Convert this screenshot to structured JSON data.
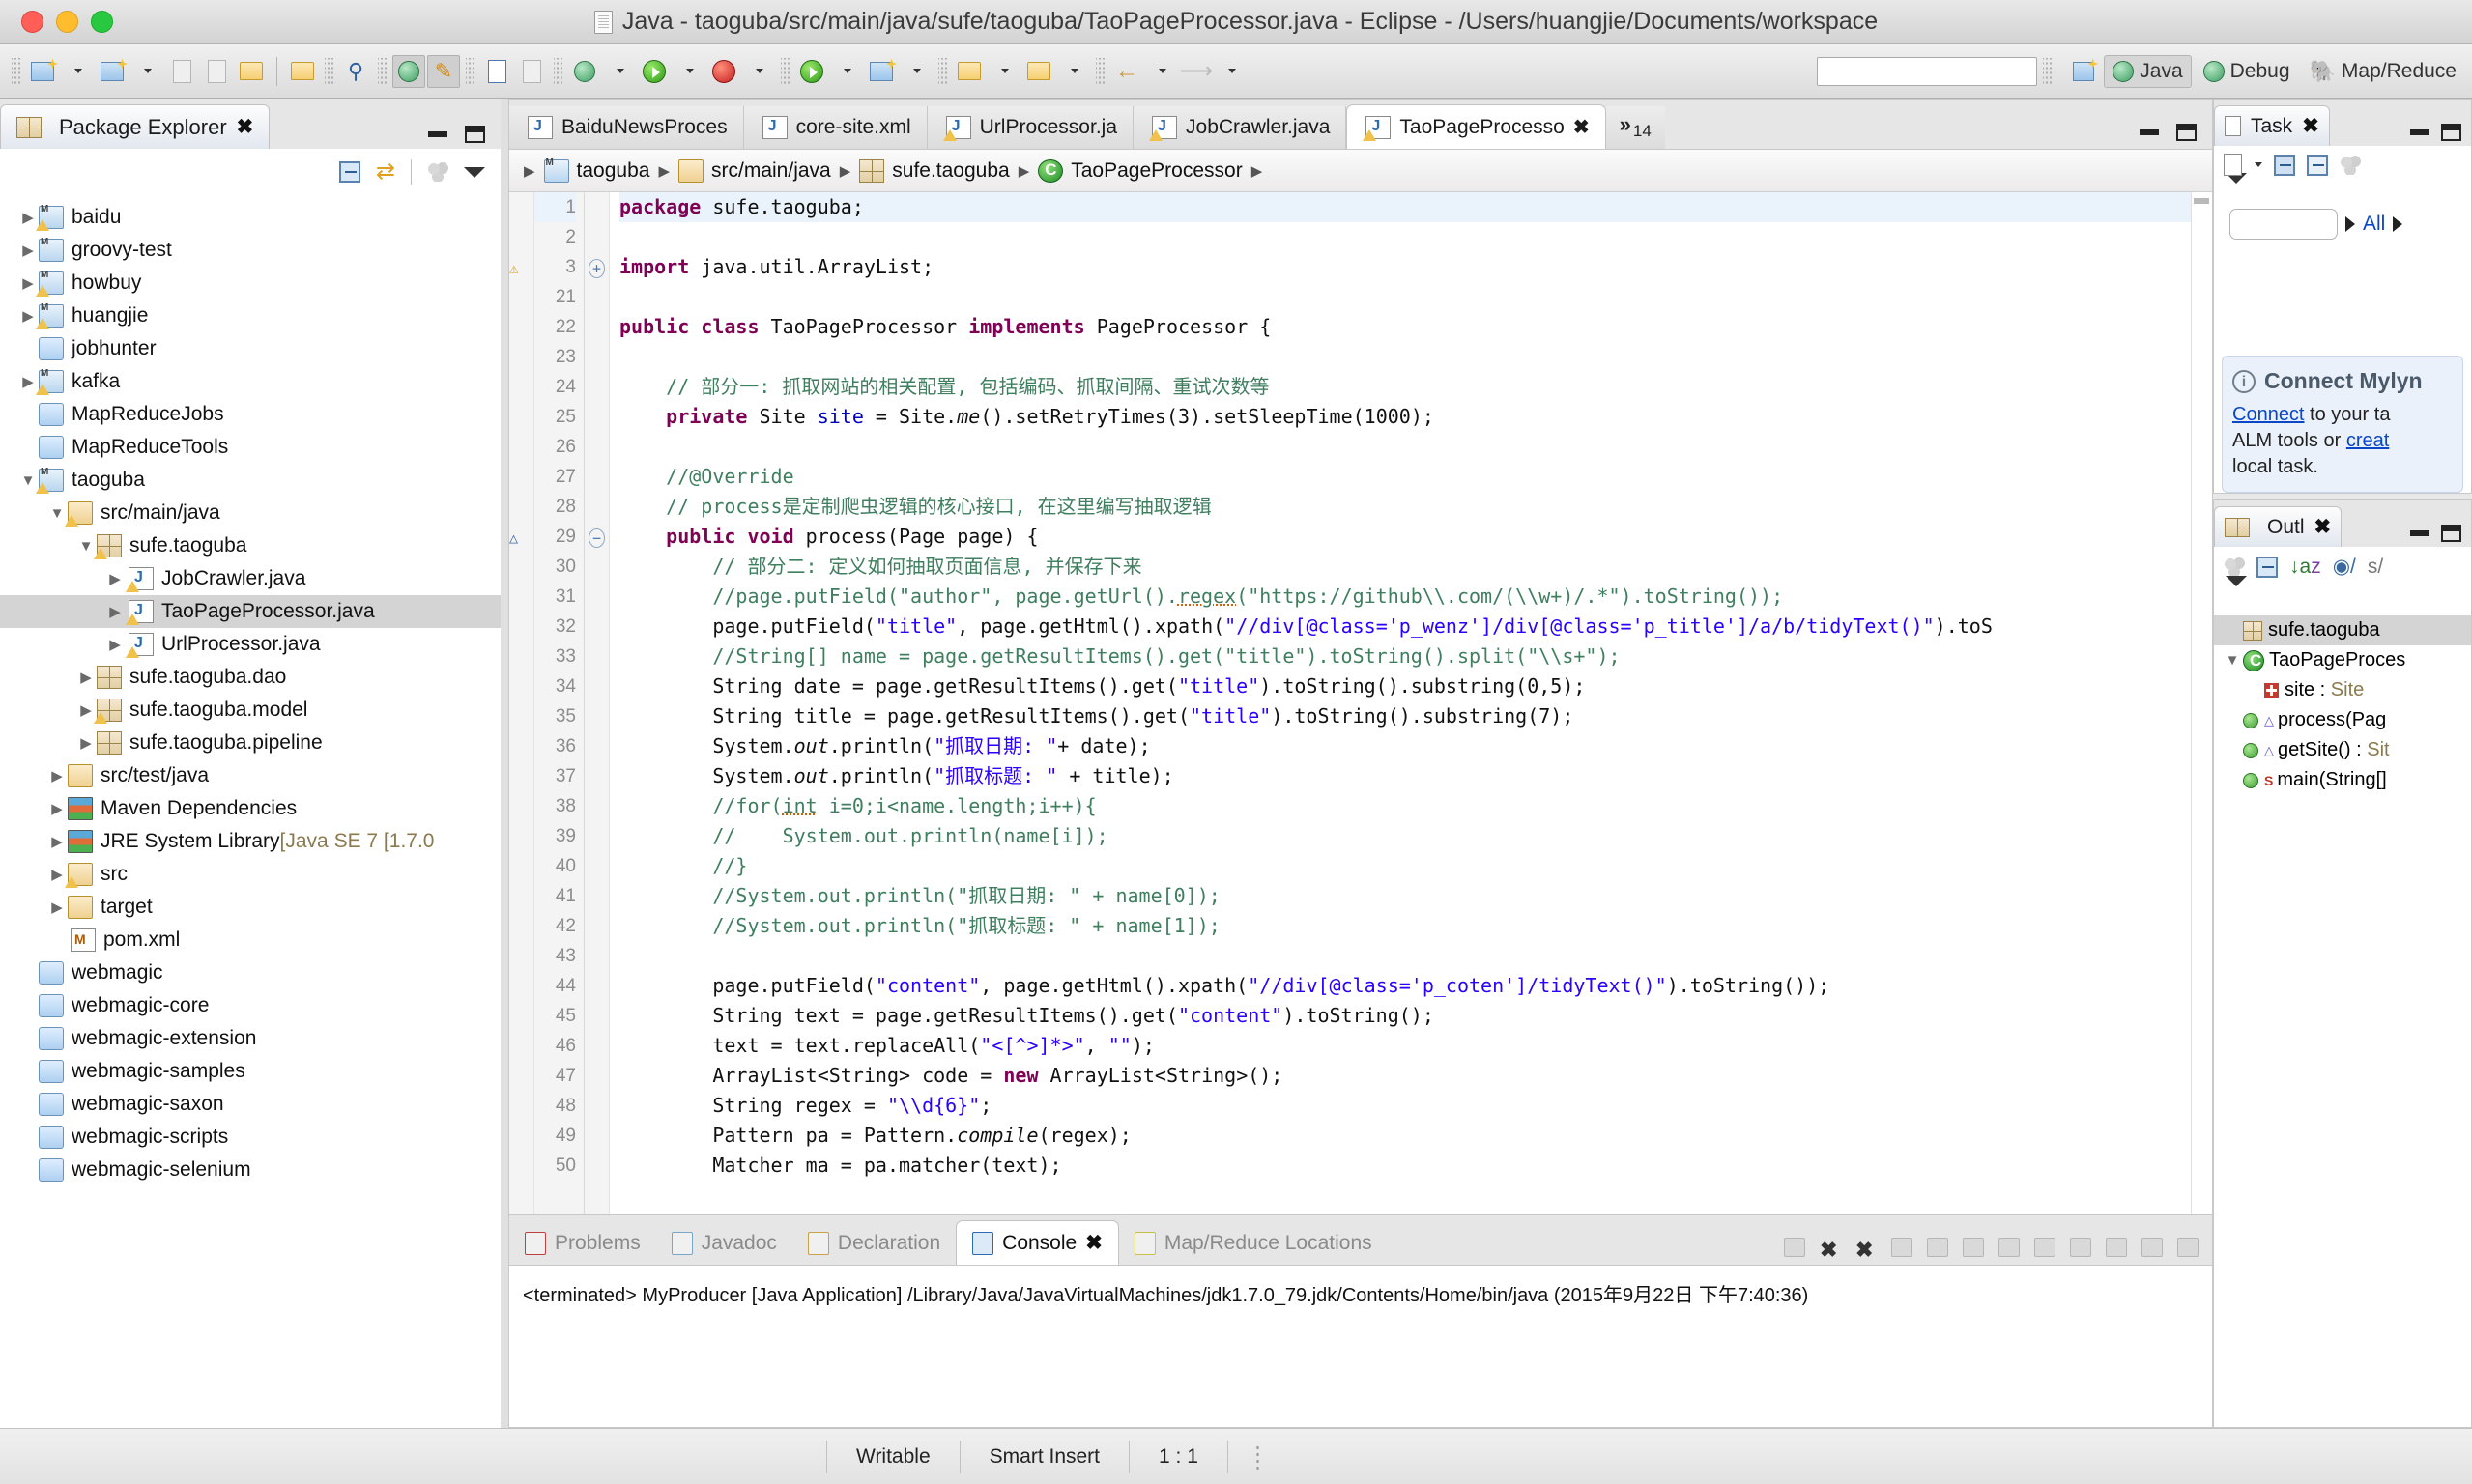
{
  "window": {
    "title": "Java - taoguba/src/main/java/sufe/taoguba/TaoPageProcessor.java - Eclipse - /Users/huangjie/Documents/workspace"
  },
  "perspectives": {
    "java": "Java",
    "debug": "Debug",
    "mapreduce": "Map/Reduce"
  },
  "package_explorer": {
    "title": "Package Explorer",
    "items": [
      {
        "label": "baidu",
        "indent": 0,
        "arrow": "right",
        "icon": "project-icon",
        "warn": true
      },
      {
        "label": "groovy-test",
        "indent": 0,
        "arrow": "right",
        "icon": "project-icon",
        "warn": false
      },
      {
        "label": "howbuy",
        "indent": 0,
        "arrow": "right",
        "icon": "project-icon",
        "warn": true
      },
      {
        "label": "huangjie",
        "indent": 0,
        "arrow": "right",
        "icon": "project-icon",
        "warn": true
      },
      {
        "label": "jobhunter",
        "indent": 0,
        "arrow": "none",
        "icon": "folder-icon",
        "warn": false
      },
      {
        "label": "kafka",
        "indent": 0,
        "arrow": "right",
        "icon": "project-icon",
        "warn": true
      },
      {
        "label": "MapReduceJobs",
        "indent": 0,
        "arrow": "none",
        "icon": "folder-icon",
        "warn": false
      },
      {
        "label": "MapReduceTools",
        "indent": 0,
        "arrow": "none",
        "icon": "folder-icon",
        "warn": false
      },
      {
        "label": "taoguba",
        "indent": 0,
        "arrow": "down",
        "icon": "project-icon",
        "warn": true
      },
      {
        "label": "src/main/java",
        "indent": 1,
        "arrow": "down",
        "icon": "source-folder-icon",
        "warn": true
      },
      {
        "label": "sufe.taoguba",
        "indent": 2,
        "arrow": "down",
        "icon": "package-icon",
        "warn": true
      },
      {
        "label": "JobCrawler.java",
        "indent": 3,
        "arrow": "right",
        "icon": "java-file-icon",
        "warn": true
      },
      {
        "label": "TaoPageProcessor.java",
        "indent": 3,
        "arrow": "right",
        "icon": "java-file-icon",
        "warn": true,
        "selected": true
      },
      {
        "label": "UrlProcessor.java",
        "indent": 3,
        "arrow": "right",
        "icon": "java-file-icon",
        "warn": true
      },
      {
        "label": "sufe.taoguba.dao",
        "indent": 2,
        "arrow": "right",
        "icon": "package-icon",
        "warn": false
      },
      {
        "label": "sufe.taoguba.model",
        "indent": 2,
        "arrow": "right",
        "icon": "package-icon",
        "warn": true
      },
      {
        "label": "sufe.taoguba.pipeline",
        "indent": 2,
        "arrow": "right",
        "icon": "package-icon",
        "warn": false
      },
      {
        "label": "src/test/java",
        "indent": 1,
        "arrow": "right",
        "icon": "source-folder-icon",
        "warn": false
      },
      {
        "label": "Maven Dependencies",
        "indent": 1,
        "arrow": "right",
        "icon": "library-icon",
        "warn": false
      },
      {
        "label": "JRE System Library",
        "suffix": " [Java SE 7 [1.7.0",
        "indent": 1,
        "arrow": "right",
        "icon": "library-icon",
        "warn": false
      },
      {
        "label": "src",
        "indent": 1,
        "arrow": "right",
        "icon": "folder-plain-icon",
        "warn": true
      },
      {
        "label": "target",
        "indent": 1,
        "arrow": "right",
        "icon": "folder-plain-icon",
        "warn": false
      },
      {
        "label": "pom.xml",
        "indent": 1,
        "arrow": "none",
        "icon": "maven-pom-icon",
        "warn": false
      },
      {
        "label": "webmagic",
        "indent": 0,
        "arrow": "none",
        "icon": "folder-icon",
        "warn": false
      },
      {
        "label": "webmagic-core",
        "indent": 0,
        "arrow": "none",
        "icon": "folder-icon",
        "warn": false
      },
      {
        "label": "webmagic-extension",
        "indent": 0,
        "arrow": "none",
        "icon": "folder-icon",
        "warn": false
      },
      {
        "label": "webmagic-samples",
        "indent": 0,
        "arrow": "none",
        "icon": "folder-icon",
        "warn": false
      },
      {
        "label": "webmagic-saxon",
        "indent": 0,
        "arrow": "none",
        "icon": "folder-icon",
        "warn": false
      },
      {
        "label": "webmagic-scripts",
        "indent": 0,
        "arrow": "none",
        "icon": "folder-icon",
        "warn": false
      },
      {
        "label": "webmagic-selenium",
        "indent": 0,
        "arrow": "none",
        "icon": "folder-icon",
        "warn": false
      }
    ]
  },
  "editor": {
    "tabs": [
      {
        "label": "BaiduNewsProces",
        "icon": "java-file-icon",
        "active": false,
        "warn": false
      },
      {
        "label": "core-site.xml",
        "icon": "xml-file-icon",
        "active": false,
        "warn": false
      },
      {
        "label": "UrlProcessor.ja",
        "icon": "java-file-icon",
        "active": false,
        "warn": true
      },
      {
        "label": "JobCrawler.java",
        "icon": "java-file-icon",
        "active": false,
        "warn": true
      },
      {
        "label": "TaoPageProcesso",
        "icon": "java-file-icon",
        "active": true,
        "warn": true
      }
    ],
    "overflow_chevron": "»",
    "overflow_count": "14",
    "breadcrumb": [
      {
        "label": "taoguba",
        "icon": "project-icon"
      },
      {
        "label": "src/main/java",
        "icon": "source-folder-icon"
      },
      {
        "label": "sufe.taoguba",
        "icon": "package-icon"
      },
      {
        "label": "TaoPageProcessor",
        "icon": "class-icon"
      }
    ],
    "lines": [
      {
        "n": "1",
        "current": true,
        "segs": [
          {
            "t": "package ",
            "c": "kw"
          },
          {
            "t": "sufe.taoguba;",
            "c": ""
          }
        ]
      },
      {
        "n": "2",
        "segs": []
      },
      {
        "n": "3",
        "ann": "warning-marker",
        "fold": "plus",
        "segs": [
          {
            "t": "import ",
            "c": "kw"
          },
          {
            "t": "java.util.ArrayList;",
            "c": ""
          }
        ]
      },
      {
        "n": "21",
        "segs": []
      },
      {
        "n": "22",
        "segs": [
          {
            "t": "public class ",
            "c": "kw"
          },
          {
            "t": "TaoPageProcessor ",
            "c": ""
          },
          {
            "t": "implements ",
            "c": "kw"
          },
          {
            "t": "PageProcessor {",
            "c": ""
          }
        ]
      },
      {
        "n": "23",
        "segs": []
      },
      {
        "n": "24",
        "segs": [
          {
            "t": "    // 部分一: 抓取网站的相关配置, 包括编码、抓取间隔、重试次数等",
            "c": "cmt"
          }
        ]
      },
      {
        "n": "25",
        "segs": [
          {
            "t": "    ",
            "c": ""
          },
          {
            "t": "private ",
            "c": "kw"
          },
          {
            "t": "Site ",
            "c": ""
          },
          {
            "t": "site",
            "c": "fld"
          },
          {
            "t": " = Site.",
            "c": ""
          },
          {
            "t": "me",
            "c": "stat"
          },
          {
            "t": "().setRetryTimes(3).setSleepTime(1000);",
            "c": ""
          }
        ]
      },
      {
        "n": "26",
        "segs": []
      },
      {
        "n": "27",
        "segs": [
          {
            "t": "    //@Override",
            "c": "cmt"
          }
        ]
      },
      {
        "n": "28",
        "segs": [
          {
            "t": "    // process是定制爬虫逻辑的核心接口, 在这里编写抽取逻辑",
            "c": "cmt"
          }
        ]
      },
      {
        "n": "29",
        "ann": "override-marker",
        "fold": "minus",
        "segs": [
          {
            "t": "    ",
            "c": ""
          },
          {
            "t": "public void ",
            "c": "kw"
          },
          {
            "t": "process(Page page) {",
            "c": ""
          }
        ]
      },
      {
        "n": "30",
        "segs": [
          {
            "t": "        // 部分二: 定义如何抽取页面信息, 并保存下来",
            "c": "cmt"
          }
        ]
      },
      {
        "n": "31",
        "segs": [
          {
            "t": "        //page.putField(\"author\", page.getUrl().",
            "c": "cmt"
          },
          {
            "t": "regex",
            "c": "cmt err"
          },
          {
            "t": "(\"https://github\\\\.com/(\\\\w+)/.*\").toString());",
            "c": "cmt"
          }
        ]
      },
      {
        "n": "32",
        "segs": [
          {
            "t": "        page.putField(",
            "c": ""
          },
          {
            "t": "\"title\"",
            "c": "str"
          },
          {
            "t": ", page.getHtml().xpath(",
            "c": ""
          },
          {
            "t": "\"//div[@class='p_wenz']/div[@class='p_title']/a/b/tidyText()\"",
            "c": "str"
          },
          {
            "t": ").toS",
            "c": ""
          }
        ]
      },
      {
        "n": "33",
        "segs": [
          {
            "t": "        //String[] name = page.getResultItems().get(\"title\").toString().split(\"\\\\s+\");",
            "c": "cmt"
          }
        ]
      },
      {
        "n": "34",
        "segs": [
          {
            "t": "        String date = page.getResultItems().get(",
            "c": ""
          },
          {
            "t": "\"title\"",
            "c": "str"
          },
          {
            "t": ").toString().substring(0,5);",
            "c": ""
          }
        ]
      },
      {
        "n": "35",
        "segs": [
          {
            "t": "        String title = page.getResultItems().get(",
            "c": ""
          },
          {
            "t": "\"title\"",
            "c": "str"
          },
          {
            "t": ").toString().substring(7);",
            "c": ""
          }
        ]
      },
      {
        "n": "36",
        "segs": [
          {
            "t": "        System.",
            "c": ""
          },
          {
            "t": "out",
            "c": "stat"
          },
          {
            "t": ".println(",
            "c": ""
          },
          {
            "t": "\"抓取日期: \"",
            "c": "str"
          },
          {
            "t": "+ date);",
            "c": ""
          }
        ]
      },
      {
        "n": "37",
        "segs": [
          {
            "t": "        System.",
            "c": ""
          },
          {
            "t": "out",
            "c": "stat"
          },
          {
            "t": ".println(",
            "c": ""
          },
          {
            "t": "\"抓取标题: \"",
            "c": "str"
          },
          {
            "t": " + title);",
            "c": ""
          }
        ]
      },
      {
        "n": "38",
        "segs": [
          {
            "t": "        //for(",
            "c": "cmt"
          },
          {
            "t": "int",
            "c": "cmt err"
          },
          {
            "t": " i=0;i<name.length;i++){",
            "c": "cmt"
          }
        ]
      },
      {
        "n": "39",
        "segs": [
          {
            "t": "        //    System.out.println(name[i]);",
            "c": "cmt"
          }
        ]
      },
      {
        "n": "40",
        "segs": [
          {
            "t": "        //}",
            "c": "cmt"
          }
        ]
      },
      {
        "n": "41",
        "segs": [
          {
            "t": "        //System.out.println(\"抓取日期: \" + name[0]);",
            "c": "cmt"
          }
        ]
      },
      {
        "n": "42",
        "segs": [
          {
            "t": "        //System.out.println(\"抓取标题: \" + name[1]);",
            "c": "cmt"
          }
        ]
      },
      {
        "n": "43",
        "segs": []
      },
      {
        "n": "44",
        "segs": [
          {
            "t": "        page.putField(",
            "c": ""
          },
          {
            "t": "\"content\"",
            "c": "str"
          },
          {
            "t": ", page.getHtml().xpath(",
            "c": ""
          },
          {
            "t": "\"//div[@class='p_coten']/tidyText()\"",
            "c": "str"
          },
          {
            "t": ").toString());",
            "c": ""
          }
        ]
      },
      {
        "n": "45",
        "segs": [
          {
            "t": "        String text = page.getResultItems().get(",
            "c": ""
          },
          {
            "t": "\"content\"",
            "c": "str"
          },
          {
            "t": ").toString();",
            "c": ""
          }
        ]
      },
      {
        "n": "46",
        "segs": [
          {
            "t": "        text = text.replaceAll(",
            "c": ""
          },
          {
            "t": "\"<[^>]*>\"",
            "c": "str"
          },
          {
            "t": ", ",
            "c": ""
          },
          {
            "t": "\"\"",
            "c": "str"
          },
          {
            "t": ");",
            "c": ""
          }
        ]
      },
      {
        "n": "47",
        "segs": [
          {
            "t": "        ArrayList<String> code = ",
            "c": ""
          },
          {
            "t": "new ",
            "c": "kw"
          },
          {
            "t": "ArrayList<String>();",
            "c": ""
          }
        ]
      },
      {
        "n": "48",
        "segs": [
          {
            "t": "        String regex = ",
            "c": ""
          },
          {
            "t": "\"\\\\d{6}\"",
            "c": "str"
          },
          {
            "t": ";",
            "c": ""
          }
        ]
      },
      {
        "n": "49",
        "segs": [
          {
            "t": "        Pattern pa = Pattern.",
            "c": ""
          },
          {
            "t": "compile",
            "c": "stat"
          },
          {
            "t": "(regex);",
            "c": ""
          }
        ]
      },
      {
        "n": "50",
        "segs": [
          {
            "t": "        Matcher ma = pa.matcher(text);",
            "c": ""
          }
        ]
      }
    ]
  },
  "bottom_panel": {
    "tabs": [
      {
        "label": "Problems",
        "icon": "problems-icon",
        "active": false
      },
      {
        "label": "Javadoc",
        "icon": "javadoc-icon",
        "active": false
      },
      {
        "label": "Declaration",
        "icon": "declaration-icon",
        "active": false
      },
      {
        "label": "Console",
        "icon": "console-icon",
        "active": true
      },
      {
        "label": "Map/Reduce Locations",
        "icon": "mapreduce-icon",
        "active": false
      }
    ],
    "console_output": "<terminated> MyProducer [Java Application] /Library/Java/JavaVirtualMachines/jdk1.7.0_79.jdk/Contents/Home/bin/java (2015年9月22日 下午7:40:36)"
  },
  "task_panel": {
    "title": "Task",
    "filter_value": "",
    "all_label": "All",
    "mylyn": {
      "heading": "Connect Mylyn",
      "line1_a": "Connect",
      "line1_b": " to your ta",
      "line2_a": "ALM tools or ",
      "line2_b": "creat",
      "line3": "local task."
    }
  },
  "outline_panel": {
    "title": "Outl",
    "items": [
      {
        "label": "sufe.taoguba",
        "icon": "package-icon",
        "indent": 1,
        "arrow": "none",
        "selected": true
      },
      {
        "label": "TaoPageProces",
        "icon": "class-icon",
        "indent": 0,
        "arrow": "down",
        "selected": false
      },
      {
        "label": "site : Site",
        "icon": "field-icon",
        "indent": 2,
        "arrow": "none",
        "selected": false
      },
      {
        "label": "process(Pag",
        "icon": "method-icon",
        "indent": 1,
        "arrow": "none",
        "selected": false
      },
      {
        "label": "getSite() : Sit",
        "icon": "method-icon",
        "indent": 1,
        "arrow": "none",
        "selected": false
      },
      {
        "label": "main(String[]",
        "icon": "method-static-icon",
        "indent": 1,
        "arrow": "none",
        "selected": false
      }
    ]
  },
  "status_bar": {
    "writable": "Writable",
    "insert_mode": "Smart Insert",
    "position": "1 : 1"
  }
}
